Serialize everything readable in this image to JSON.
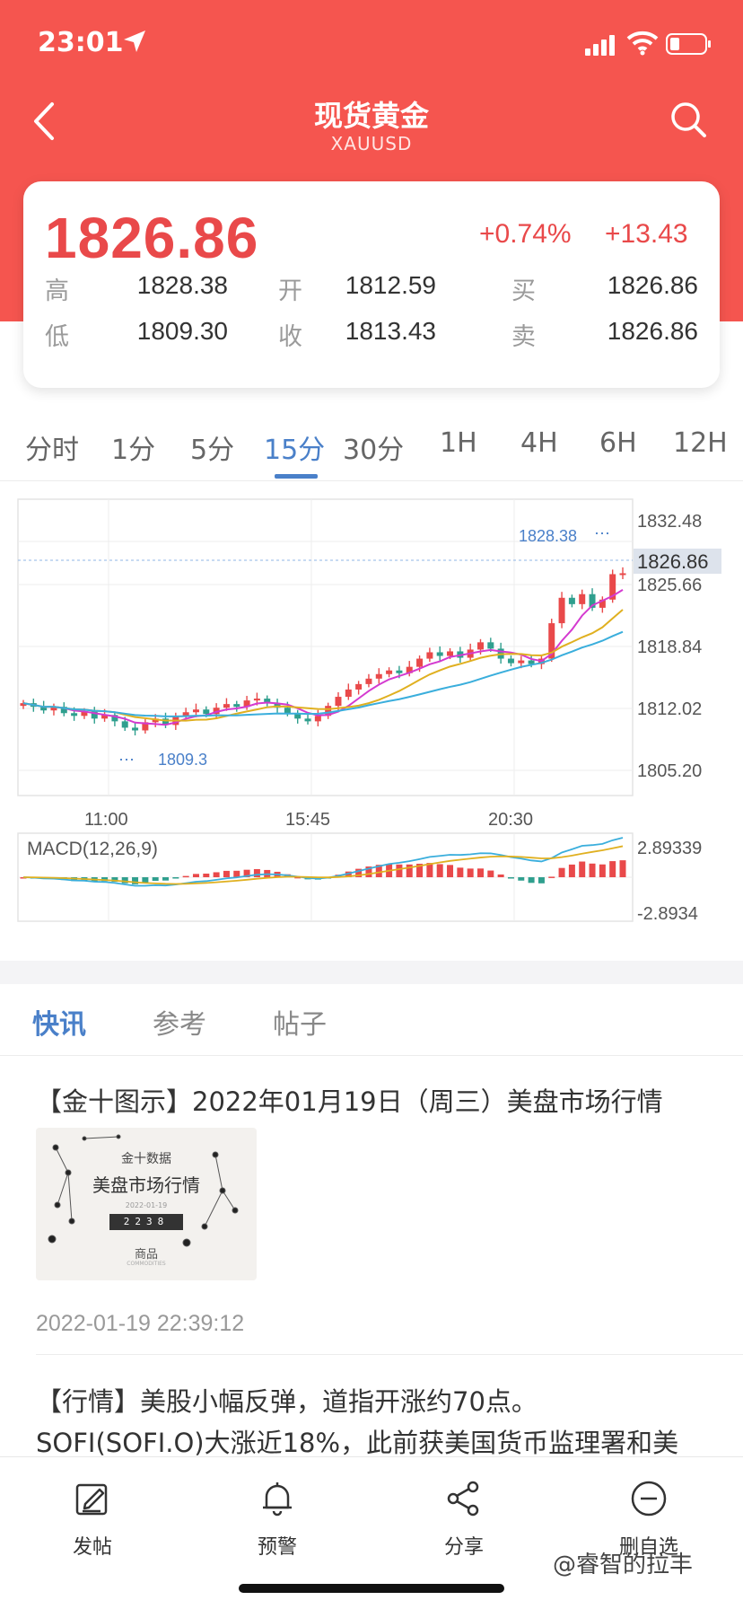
{
  "status_bar": {
    "time": "23:01"
  },
  "nav": {
    "title": "现货黄金",
    "subtitle": "XAUUSD"
  },
  "quote": {
    "price": "1826.86",
    "change_pct": "+0.74%",
    "change": "+13.43",
    "fields": [
      {
        "label": "高",
        "value": "1828.38"
      },
      {
        "label": "开",
        "value": "1812.59"
      },
      {
        "label": "买",
        "value": "1826.86"
      },
      {
        "label": "低",
        "value": "1809.30"
      },
      {
        "label": "收",
        "value": "1813.43"
      },
      {
        "label": "卖",
        "value": "1826.86"
      }
    ]
  },
  "period_tabs": [
    "分时",
    "1分",
    "5分",
    "15分",
    "30分",
    "1H",
    "4H",
    "6H",
    "12H"
  ],
  "active_period": "15分",
  "colors": {
    "brand_red": "#f5554f",
    "up": "#e9494a",
    "down": "#2f9f8e",
    "accent_blue": "#4a80c9",
    "ma5": "#d43ad0",
    "ma10": "#e0b020",
    "ma20": "#3aaedc"
  },
  "chart_data": [
    {
      "type": "candlestick",
      "y_ticks": [
        "1832.48",
        "1825.66",
        "1818.84",
        "1812.02",
        "1805.20"
      ],
      "ylim": [
        1805.2,
        1832.48
      ],
      "x_ticks": [
        "11:00",
        "15:45",
        "20:30"
      ],
      "last_price_tag": "1826.86",
      "high_marker": "1828.38",
      "low_marker": "1809.3",
      "closes": [
        1812.6,
        1812.2,
        1811.8,
        1812.2,
        1811.5,
        1811.2,
        1811.7,
        1810.9,
        1811.3,
        1810.6,
        1809.9,
        1809.6,
        1810.5,
        1810.9,
        1810.2,
        1811.2,
        1811.6,
        1811.9,
        1811.4,
        1812.1,
        1812.5,
        1812.2,
        1812.9,
        1813.1,
        1812.6,
        1812.1,
        1811.5,
        1810.9,
        1810.6,
        1811.2,
        1812.3,
        1813.3,
        1814.1,
        1814.7,
        1815.3,
        1815.8,
        1816.2,
        1815.9,
        1816.6,
        1817.5,
        1818.2,
        1817.8,
        1818.3,
        1817.6,
        1818.5,
        1819.3,
        1818.6,
        1817.5,
        1817.0,
        1817.3,
        1816.9,
        1817.5,
        1821.4,
        1824.2,
        1823.5,
        1824.6,
        1823.1,
        1824.0,
        1826.8,
        1826.9
      ],
      "ma_lines": [
        "MA5",
        "MA10",
        "MA20"
      ]
    },
    {
      "type": "bar",
      "title": "MACD(12,26,9)",
      "y_ticks": [
        "2.89339",
        "-2.8934"
      ]
    }
  ],
  "news_tabs": [
    "快讯",
    "参考",
    "帖子"
  ],
  "active_news_tab": "快讯",
  "news": [
    {
      "title": "【金十图示】2022年01月19日（周三）美盘市场行情",
      "thumb": {
        "brand": "金十数据",
        "headline": "美盘市场行情",
        "date": "2022-01-19",
        "digits": "2238",
        "category": "商品",
        "category_en": "COMMODITIES"
      },
      "time": "2022-01-19 22:39:12"
    },
    {
      "text_line1": "【行情】美股小幅反弹，道指开涨约70点。",
      "text_line2": "SOFI(SOFI.O)大涨近18%，此前获美国货币监理署和美"
    }
  ],
  "bottom_bar": [
    {
      "label": "发帖",
      "icon": "edit-icon"
    },
    {
      "label": "预警",
      "icon": "bell-icon"
    },
    {
      "label": "分享",
      "icon": "share-icon"
    },
    {
      "label": "删自选",
      "icon": "remove-circle-icon"
    }
  ],
  "watermark": "@睿智的拉丰"
}
